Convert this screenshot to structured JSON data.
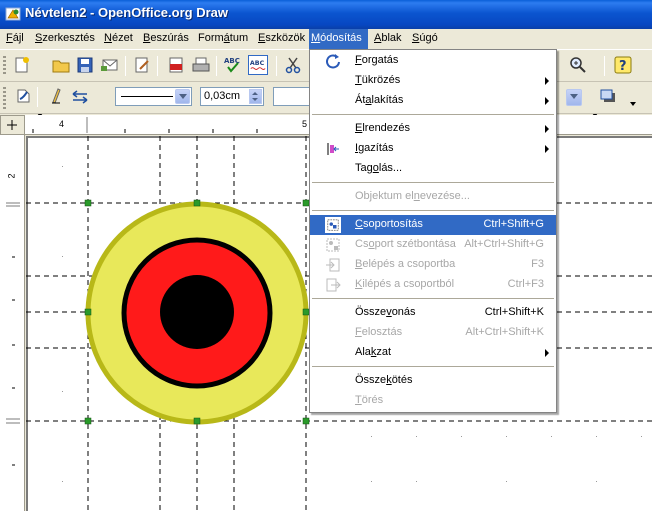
{
  "window": {
    "title": "Névtelen2 - OpenOffice.org Draw"
  },
  "menubar": [
    {
      "pre": "",
      "key": "F",
      "post": "ájl"
    },
    {
      "pre": "",
      "key": "S",
      "post": "zerkesztés"
    },
    {
      "pre": "",
      "key": "N",
      "post": "ézet"
    },
    {
      "pre": "",
      "key": "B",
      "post": "eszúrás"
    },
    {
      "pre": "Form",
      "key": "á",
      "post": "tum"
    },
    {
      "pre": "",
      "key": "E",
      "post": "szközök"
    },
    {
      "pre": "",
      "key": "M",
      "post": "ódosítás"
    },
    {
      "pre": "",
      "key": "A",
      "post": "blak"
    },
    {
      "pre": "",
      "key": "S",
      "post": "úgó"
    }
  ],
  "toolbar2": {
    "line_width": "0,03cm"
  },
  "ruler": {
    "h_labels": [
      "4",
      "5"
    ],
    "v_labels": [
      "2"
    ]
  },
  "menu": {
    "items": [
      {
        "pre": "",
        "key": "F",
        "post": "orgatás",
        "accel": "",
        "submenu": false,
        "disabled": false,
        "icon": "rotate-icon"
      },
      {
        "pre": "",
        "key": "T",
        "post": "ükrözés",
        "accel": "",
        "submenu": true,
        "disabled": false,
        "icon": ""
      },
      {
        "pre": "Át",
        "key": "a",
        "post": "lakítás",
        "accel": "",
        "submenu": true,
        "disabled": false,
        "icon": ""
      },
      {
        "pre": "",
        "key": "E",
        "post": "lrendezés",
        "accel": "",
        "submenu": true,
        "disabled": false,
        "icon": ""
      },
      {
        "pre": "",
        "key": "I",
        "post": "gazítás",
        "accel": "",
        "submenu": true,
        "disabled": false,
        "icon": "align-icon"
      },
      {
        "pre": "Tag",
        "key": "o",
        "post": "lás...",
        "accel": "",
        "submenu": false,
        "disabled": false,
        "icon": ""
      },
      {
        "pre": "Objektum el",
        "key": "n",
        "post": "evezése...",
        "accel": "",
        "submenu": false,
        "disabled": true,
        "icon": ""
      },
      {
        "pre": "",
        "key": "C",
        "post": "soportosítás",
        "accel": "Ctrl+Shift+G",
        "submenu": false,
        "disabled": false,
        "icon": "group-icon",
        "highlight": true
      },
      {
        "pre": "Cs",
        "key": "o",
        "post": "port szétbontása",
        "accel": "Alt+Ctrl+Shift+G",
        "submenu": false,
        "disabled": true,
        "icon": "ungroup-icon"
      },
      {
        "pre": "",
        "key": "B",
        "post": "elépés a csoportba",
        "accel": "F3",
        "submenu": false,
        "disabled": true,
        "icon": "enter-group-icon"
      },
      {
        "pre": "",
        "key": "K",
        "post": "ilépés a csoportból",
        "accel": "Ctrl+F3",
        "submenu": false,
        "disabled": true,
        "icon": "exit-group-icon"
      },
      {
        "pre": "Össze",
        "key": "v",
        "post": "onás",
        "accel": "Ctrl+Shift+K",
        "submenu": false,
        "disabled": false,
        "icon": ""
      },
      {
        "pre": "",
        "key": "F",
        "post": "elosztás",
        "accel": "Alt+Ctrl+Shift+K",
        "submenu": false,
        "disabled": true,
        "icon": ""
      },
      {
        "pre": "Ala",
        "key": "k",
        "post": "zat",
        "accel": "",
        "submenu": true,
        "disabled": false,
        "icon": ""
      },
      {
        "pre": "Össze",
        "key": "k",
        "post": "ötés",
        "accel": "",
        "submenu": false,
        "disabled": false,
        "icon": ""
      },
      {
        "pre": "",
        "key": "T",
        "post": "örés",
        "accel": "",
        "submenu": false,
        "disabled": true,
        "icon": ""
      }
    ]
  },
  "colors": {
    "ring_outer": "#e8e85a",
    "ring_mid": "#ff1a1a",
    "center": "#000000",
    "selection": "#2a9a2a",
    "highlight": "#316ac5"
  }
}
